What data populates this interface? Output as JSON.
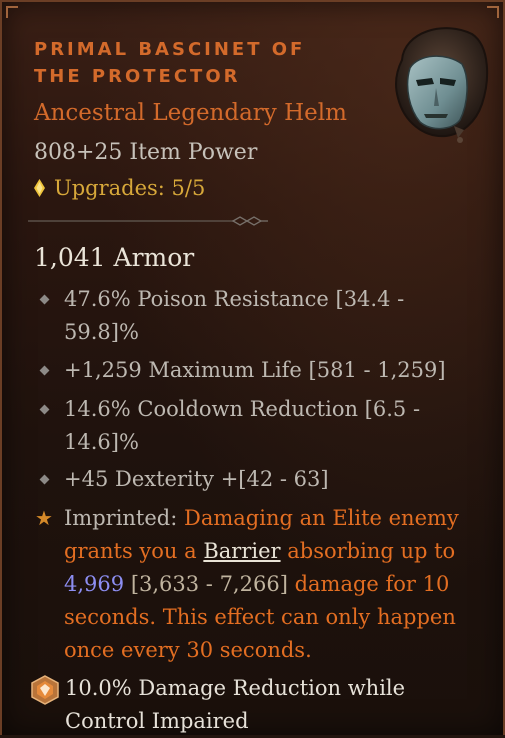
{
  "item": {
    "name": "Primal Bascinet of the Protector",
    "type": "Ancestral Legendary Helm",
    "power": "808+25 Item Power",
    "upgrades": "Upgrades: 5/5"
  },
  "stats": {
    "armor": "1,041 Armor",
    "affixes": [
      "47.6% Poison Resistance [34.4 - 59.8]%",
      "+1,259 Maximum Life [581 - 1,259]",
      "14.6% Cooldown Reduction [6.5 - 14.6]%",
      "+45 Dexterity +[42 - 63]"
    ]
  },
  "imprint": {
    "label": "Imprinted:",
    "part1": "Damaging an Elite enemy grants you a",
    "barrier": "Barrier",
    "part2": "absorbing up to",
    "value": "4,969",
    "range": "[3,633 - 7,266]",
    "part3": "damage for 10 seconds. This effect can only happen once every 30 seconds."
  },
  "special": {
    "text": "10.0% Damage Reduction while Control Impaired"
  },
  "colors": {
    "legendary": "#d36a2b",
    "upgrade": "#d7a83a",
    "affix": "#bdb8b1",
    "value_highlight": "#8d8ef2",
    "background": "#22150f"
  },
  "icons": [
    "upgrade-diamond-icon",
    "divider-ornament",
    "helm-item-icon",
    "affix-bullet-icon",
    "imprint-star-icon",
    "damage-reduction-gem-icon"
  ]
}
